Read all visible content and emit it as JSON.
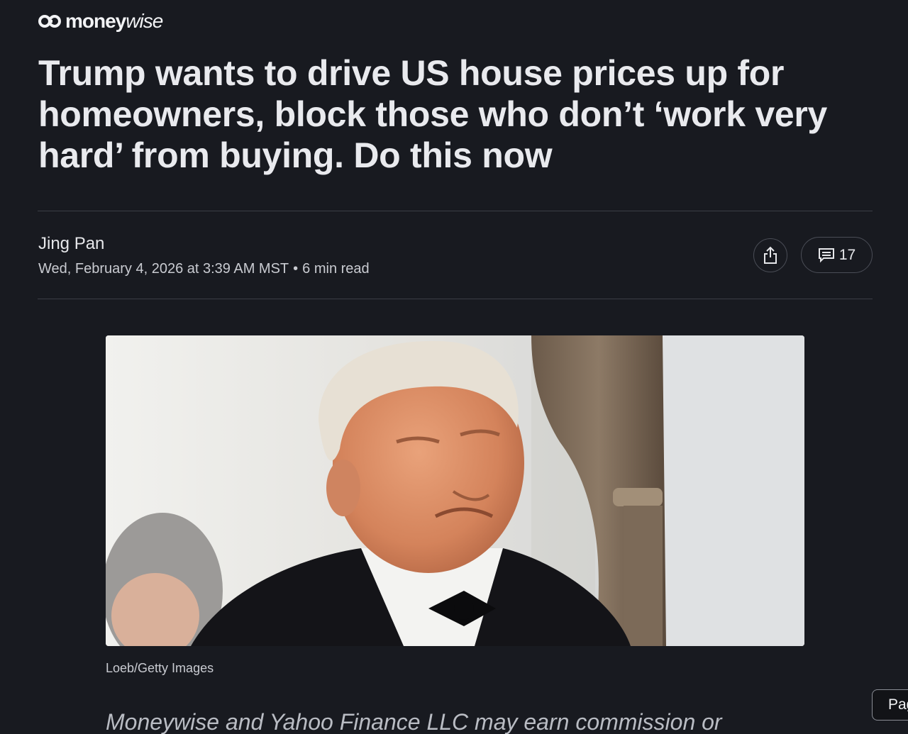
{
  "brand": {
    "logo_bold": "money",
    "logo_light": "wise"
  },
  "article": {
    "headline": "Trump wants to drive US house prices up for homeowners, block those who don’t ‘work very hard’ from buying. Do this now",
    "author": "Jing Pan",
    "date": "Wed, February 4, 2026 at 3:39 AM MST",
    "separator": "•",
    "read_time": "6 min read"
  },
  "actions": {
    "share_icon": "share-icon",
    "comments_icon": "comment-icon",
    "comment_count": "17"
  },
  "image": {
    "caption": "Loeb/Getty Images"
  },
  "disclaimer": "Moneywise and Yahoo Finance LLC may earn commission or",
  "page_tab": {
    "label": "Pag"
  },
  "colors": {
    "background": "#181a20",
    "text": "#e9eaee",
    "muted": "#c9cbd1",
    "border": "#4a4d56"
  }
}
